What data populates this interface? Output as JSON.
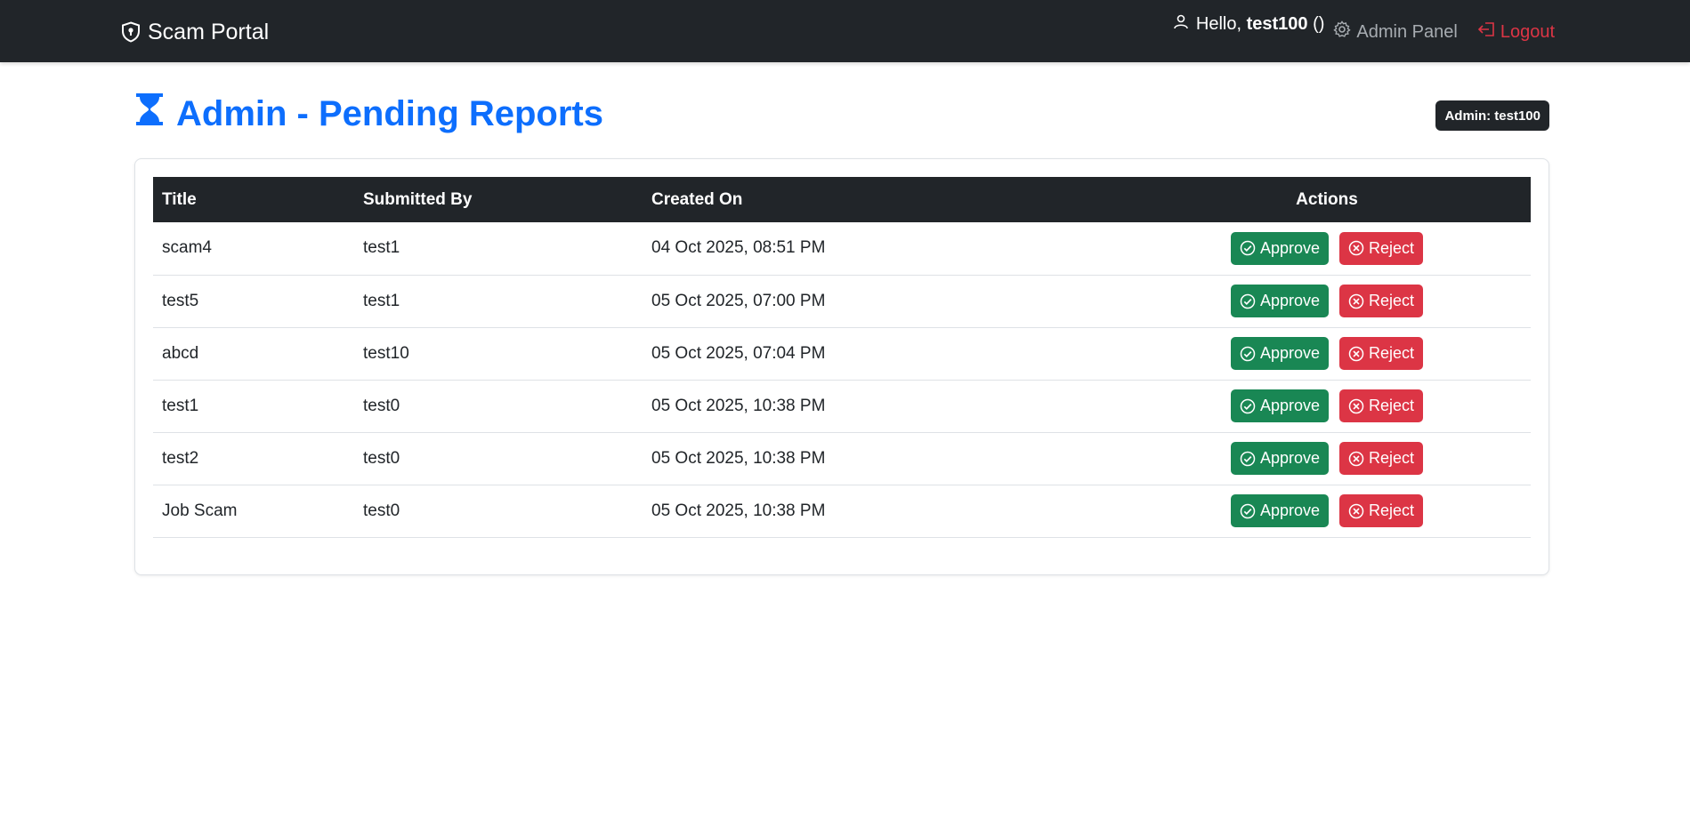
{
  "navbar": {
    "brand": "Scam Portal",
    "hello_prefix": "Hello, ",
    "username": "test100",
    "role_paren": " ()",
    "admin_panel": "Admin Panel",
    "logout": "Logout"
  },
  "header": {
    "title": "Admin - Pending Reports",
    "badge": "Admin: test100"
  },
  "table": {
    "columns": [
      "Title",
      "Submitted By",
      "Created On",
      "Actions"
    ],
    "rows": [
      {
        "title": "scam4",
        "submitted_by": "test1",
        "created_on": "04 Oct 2025, 08:51 PM"
      },
      {
        "title": "test5",
        "submitted_by": "test1",
        "created_on": "05 Oct 2025, 07:00 PM"
      },
      {
        "title": "abcd",
        "submitted_by": "test10",
        "created_on": "05 Oct 2025, 07:04 PM"
      },
      {
        "title": "test1",
        "submitted_by": "test0",
        "created_on": "05 Oct 2025, 10:38 PM"
      },
      {
        "title": "test2",
        "submitted_by": "test0",
        "created_on": "05 Oct 2025, 10:38 PM"
      },
      {
        "title": "Job Scam",
        "submitted_by": "test0",
        "created_on": "05 Oct 2025, 10:38 PM"
      }
    ],
    "approve_label": "Approve",
    "reject_label": "Reject"
  },
  "colors": {
    "navbar": "#212529",
    "primary": "#0d6efd",
    "success": "#198754",
    "danger": "#dc3545"
  },
  "icons": {
    "brand": "shield-icon",
    "user": "person-icon",
    "admin_panel": "gear-icon",
    "logout": "logout-icon",
    "title": "hourglass-icon",
    "approve": "check-circle-icon",
    "reject": "x-circle-icon"
  }
}
